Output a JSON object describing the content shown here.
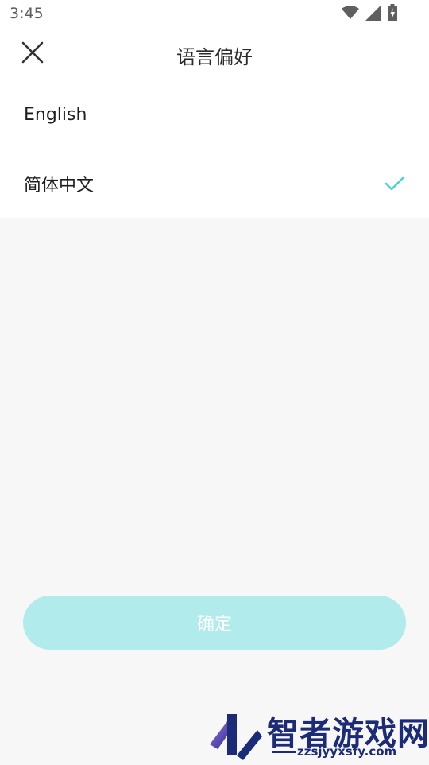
{
  "status_bar": {
    "time": "3:45",
    "icons": [
      "wifi-icon",
      "signal-icon",
      "battery-charging-icon"
    ]
  },
  "header": {
    "title": "语言偏好",
    "close_icon": "close-icon"
  },
  "languages": [
    {
      "label": "English",
      "selected": false
    },
    {
      "label": "简体中文",
      "selected": true
    }
  ],
  "confirm_button": {
    "label": "确定"
  },
  "watermark": {
    "title": "智者游戏网",
    "domain": "zzsjyyxsfy.com"
  },
  "colors": {
    "accent": "#4fd3d3",
    "button_bg": "#b2ebeb",
    "page_bg": "#f7f7f7",
    "watermark": "#1c2b78"
  }
}
